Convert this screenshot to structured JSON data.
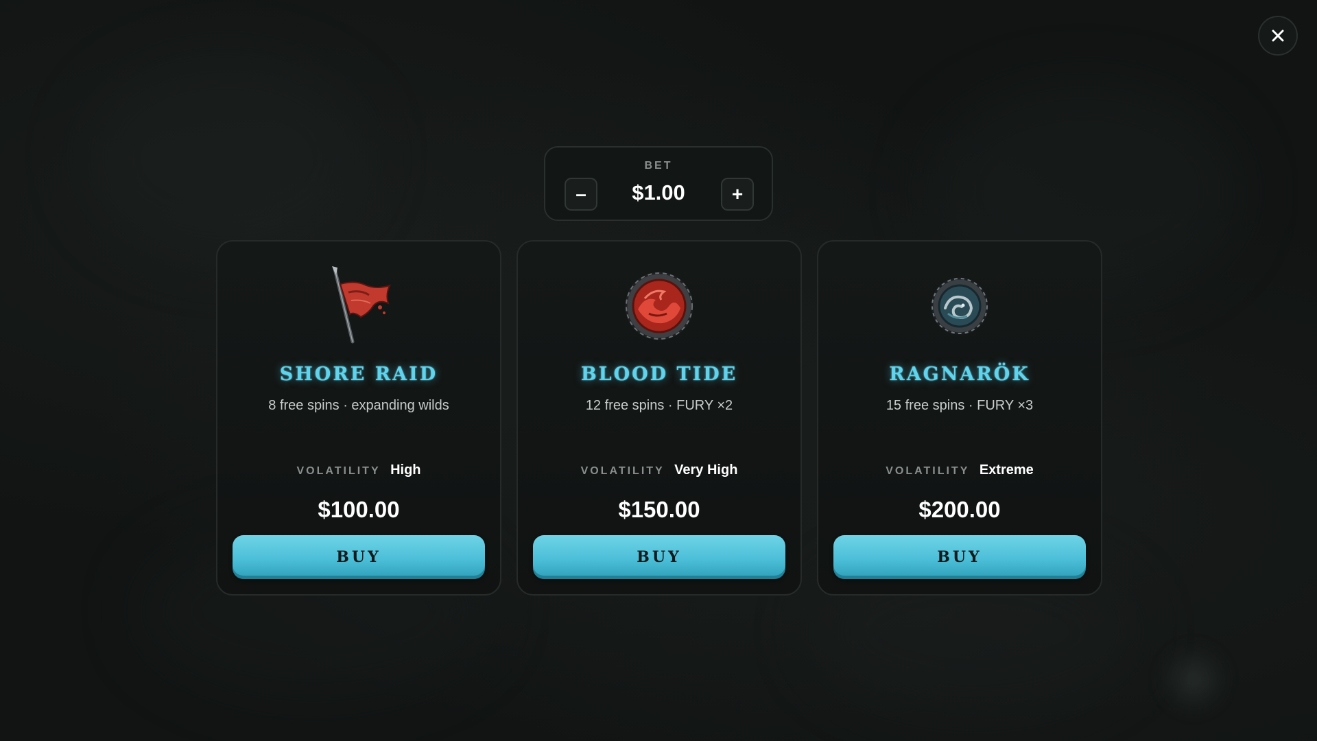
{
  "bet": {
    "label": "BET",
    "value": "$1.00",
    "minus_label": "–",
    "plus_label": "+"
  },
  "close": {
    "icon": "close-icon"
  },
  "cards": [
    {
      "title": "SHORE RAID",
      "description": "8 free spins · expanding wilds",
      "volatility_label": "VOLATILITY",
      "volatility_value": "High",
      "price": "$100.00",
      "buy_label": "BUY",
      "icon": "war-banner-icon"
    },
    {
      "title": "BLOOD TIDE",
      "description": "12 free spins · FURY ×2",
      "volatility_label": "VOLATILITY",
      "volatility_value": "Very High",
      "price": "$150.00",
      "buy_label": "BUY",
      "icon": "blood-wave-shield-icon"
    },
    {
      "title": "RAGNARÖK",
      "description": "15 free spins · FURY ×3",
      "volatility_label": "VOLATILITY",
      "volatility_value": "Extreme",
      "price": "$200.00",
      "buy_label": "BUY",
      "icon": "serpent-shield-icon"
    }
  ],
  "colors": {
    "accent": "#5fd4ec",
    "button": "#4cbfd8",
    "background": "#111413"
  }
}
